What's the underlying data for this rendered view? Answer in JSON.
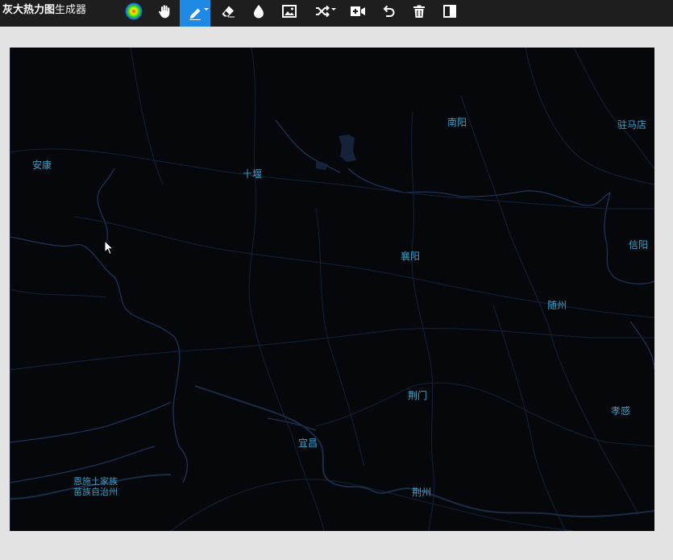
{
  "app": {
    "title_bold": "灰大热力图",
    "title_rest": "生成器"
  },
  "toolbar": {
    "tools": [
      {
        "icon": "gradient-icon",
        "label": ""
      },
      {
        "icon": "hand-icon",
        "label": ""
      },
      {
        "icon": "pen-icon",
        "label": "",
        "active": true
      },
      {
        "icon": "eraser-icon",
        "label": ""
      },
      {
        "icon": "drop-icon",
        "label": ""
      },
      {
        "icon": "image-icon",
        "label": ""
      },
      {
        "icon": "shuffle-icon",
        "label": ""
      },
      {
        "icon": "add-video-icon",
        "label": ""
      },
      {
        "icon": "undo-icon",
        "label": ""
      },
      {
        "icon": "trash-icon",
        "label": ""
      },
      {
        "icon": "split-view-icon",
        "label": ""
      }
    ],
    "active_color": "#1e88e5"
  },
  "map": {
    "background": "#05070b",
    "label_color": "#3aa0c8",
    "cities": {
      "nanyang": "南阳",
      "zhumadian": "驻马店",
      "ankang": "安康",
      "shiyan": "十堰",
      "xinyang": "信阳",
      "xiangyang": "襄阳",
      "suizhou": "随州",
      "jingmen": "荆门",
      "xiaogan": "孝感",
      "yichang": "宜昌",
      "enshi_line1": "恩施土家族",
      "enshi_line2": "苗族自治州",
      "jingzhou": "荆州"
    }
  }
}
